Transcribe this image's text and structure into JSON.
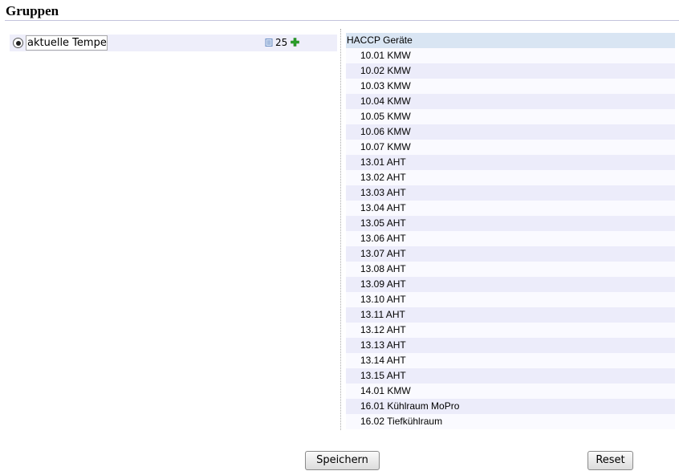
{
  "page": {
    "title": "Gruppen"
  },
  "groups": [
    {
      "name": "aktuelle Tempe",
      "count": "25",
      "selected": true
    }
  ],
  "device_list": {
    "header": "HACCP Geräte",
    "items": [
      "10.01 KMW",
      "10.02 KMW",
      "10.03 KMW",
      "10.04 KMW",
      "10.05 KMW",
      "10.06 KMW",
      "10.07 KMW",
      "13.01 AHT",
      "13.02 AHT",
      "13.03 AHT",
      "13.04 AHT",
      "13.05 AHT",
      "13.06 AHT",
      "13.07 AHT",
      "13.08 AHT",
      "13.09 AHT",
      "13.10 AHT",
      "13.11 AHT",
      "13.12 AHT",
      "13.13 AHT",
      "13.14 AHT",
      "13.15 AHT",
      "14.01 KMW",
      "16.01 Kühlraum MoPro",
      "16.02 Tiefkühlraum"
    ]
  },
  "buttons": {
    "save_label": "Speichern",
    "reset_label": "Reset"
  },
  "icons": {
    "document": "document-icon",
    "add": "add-icon"
  },
  "colors": {
    "row_background": "#eeeefa",
    "list_header_background": "#d9e5f3",
    "list_alt_row": "#ececfa",
    "add_icon_green": "#2aa02a"
  }
}
